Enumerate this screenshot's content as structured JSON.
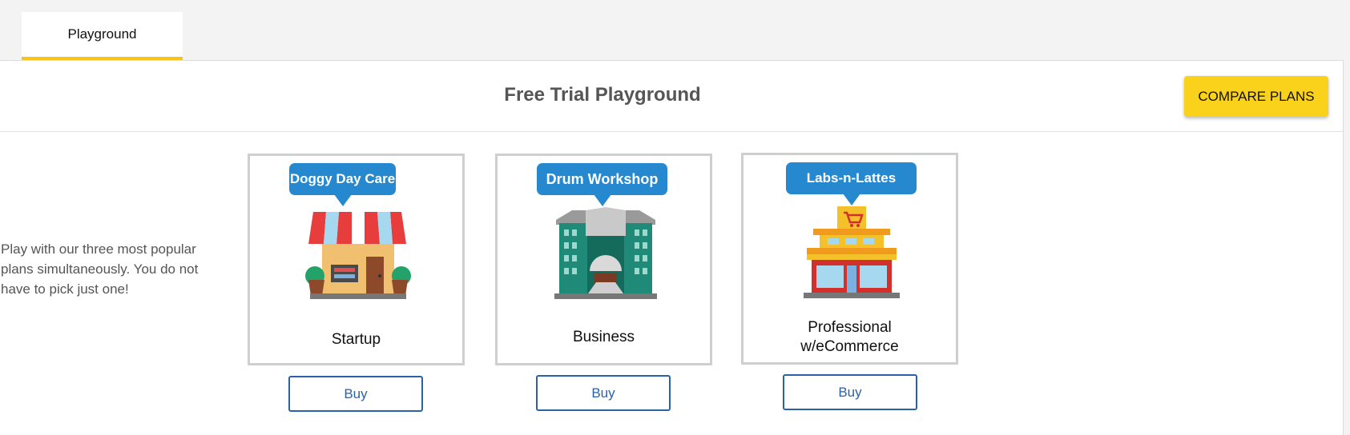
{
  "tabs": [
    {
      "label": "Playground"
    }
  ],
  "header": {
    "title": "Free Trial Playground",
    "compare_label": "COMPARE PLANS"
  },
  "intro": "Play with our three most popular plans simultaneously. You do not have to pick just one!",
  "plans": [
    {
      "sample": "Doggy Day Care",
      "name": "Startup",
      "buy_label": "Buy",
      "icon": "storefront-icon"
    },
    {
      "sample": "Drum Workshop",
      "name": "Business",
      "buy_label": "Buy",
      "icon": "office-building-icon"
    },
    {
      "sample": "Labs-n-Lattes",
      "name": "Professional w/eCommerce",
      "buy_label": "Buy",
      "icon": "ecommerce-store-icon"
    }
  ],
  "colors": {
    "accent": "#fad21b",
    "bubble": "#2689d0",
    "button_border": "#2a62a8"
  }
}
